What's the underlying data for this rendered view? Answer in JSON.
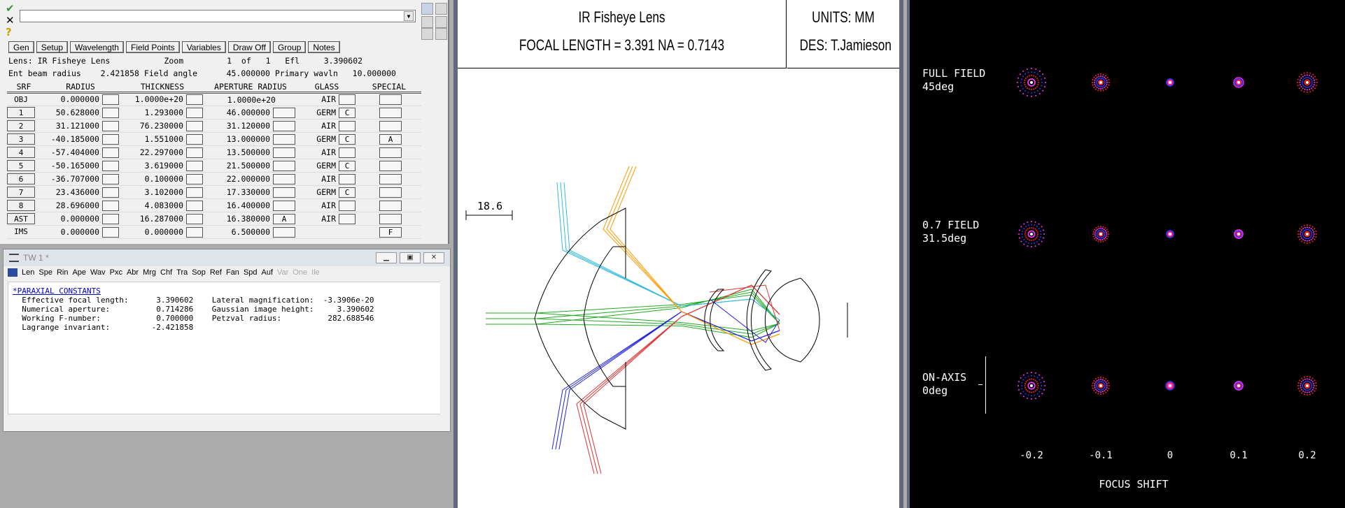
{
  "lens_editor": {
    "buttons": [
      "Gen",
      "Setup",
      "Wavelength",
      "Field Points",
      "Variables",
      "Draw Off",
      "Group",
      "Notes"
    ],
    "info1": {
      "lens_label": "Lens:",
      "lens_name": "IR Fisheye Lens",
      "zoom_label": "Zoom",
      "zoom": "1",
      "of": "of",
      "zoom_total": "1",
      "efl_label": "Efl",
      "efl": "3.390602"
    },
    "info2": {
      "ebr_label": "Ent beam radius",
      "ebr": "2.421858",
      "fa_label": "Field angle",
      "fa": "45.000000",
      "pw_label": "Primary wavln",
      "pw": "10.000000"
    },
    "headers": [
      "SRF",
      "RADIUS",
      "THICKNESS",
      "APERTURE RADIUS",
      "GLASS",
      "SPECIAL"
    ],
    "rows": [
      {
        "srf": "OBJ",
        "radius": "0.000000",
        "thickness": "1.0000e+20",
        "aperture": "1.0000e+20",
        "glass": "AIR",
        "glass_flag": "",
        "special": ""
      },
      {
        "srf": "1",
        "radius": "50.628000",
        "thickness": "1.293000",
        "aperture": "46.000000",
        "glass": "GERM",
        "glass_flag": "C",
        "special": ""
      },
      {
        "srf": "2",
        "radius": "31.121000",
        "thickness": "76.230000",
        "aperture": "31.120000",
        "glass": "AIR",
        "glass_flag": "",
        "special": ""
      },
      {
        "srf": "3",
        "radius": "-40.185000",
        "thickness": "1.551000",
        "aperture": "13.000000",
        "glass": "GERM",
        "glass_flag": "C",
        "special": "A"
      },
      {
        "srf": "4",
        "radius": "-57.404000",
        "thickness": "22.297000",
        "aperture": "13.500000",
        "glass": "AIR",
        "glass_flag": "",
        "special": ""
      },
      {
        "srf": "5",
        "radius": "-50.165000",
        "thickness": "3.619000",
        "aperture": "21.500000",
        "glass": "GERM",
        "glass_flag": "C",
        "special": ""
      },
      {
        "srf": "6",
        "radius": "-36.707000",
        "thickness": "0.100000",
        "aperture": "22.000000",
        "glass": "AIR",
        "glass_flag": "",
        "special": ""
      },
      {
        "srf": "7",
        "radius": "23.436000",
        "thickness": "3.102000",
        "aperture": "17.330000",
        "glass": "GERM",
        "glass_flag": "C",
        "special": ""
      },
      {
        "srf": "8",
        "radius": "28.696000",
        "thickness": "4.083000",
        "aperture": "16.400000",
        "glass": "AIR",
        "glass_flag": "",
        "special": ""
      },
      {
        "srf": "AST",
        "radius": "0.000000",
        "thickness": "16.287000",
        "aperture": "16.380000",
        "glass": "AIR",
        "glass_flag": "",
        "aperture_flag": "A",
        "special": ""
      },
      {
        "srf": "IMS",
        "radius": "0.000000",
        "thickness": "0.000000",
        "aperture": "6.500000",
        "glass": "",
        "glass_flag": "",
        "special": "F"
      }
    ]
  },
  "tw_window": {
    "title": "TW 1 *",
    "menu": [
      "Len",
      "Spe",
      "Rin",
      "Ape",
      "Wav",
      "Pxc",
      "Abr",
      "Mrg",
      "Chf",
      "Tra",
      "Sop",
      "Ref",
      "Fan",
      "Spd",
      "Auf"
    ],
    "menu_disabled": [
      "Var",
      "One",
      "Ile"
    ],
    "section_link": "*PARAXIAL CONSTANTS",
    "lines": [
      "  Effective focal length:      3.390602    Lateral magnification:  -3.3906e-20",
      "  Numerical aperture:          0.714286    Gaussian image height:     3.390602",
      "  Working F-number:            0.700000    Petzval radius:          282.688546",
      "  Lagrange invariant:         -2.421858"
    ]
  },
  "drawing": {
    "title": "IR Fisheye Lens",
    "subtitle": "FOCAL LENGTH = 3.391  NA = 0.7143",
    "units": "UNITS: MM",
    "designer": "DES: T.Jamieson",
    "scale_label": "18.6"
  },
  "spot": {
    "fields": [
      {
        "line1": "FULL FIELD",
        "line2": "45deg"
      },
      {
        "line1": "0.7 FIELD",
        "line2": "31.5deg"
      },
      {
        "line1": "ON-AXIS",
        "line2": "0deg"
      }
    ],
    "focus_values": [
      "-0.2",
      "-0.1",
      "0",
      "0.1",
      "0.2"
    ],
    "axis_title": "FOCUS SHIFT"
  },
  "colors": {
    "ray_green": "#22aa22",
    "ray_blue": "#2222dd",
    "ray_red": "#dd3333",
    "ray_cyan": "#33bbdd",
    "ray_orange": "#ff9900",
    "spot_red": "#ff2222",
    "spot_blue": "#3333ff",
    "spot_magenta": "#ff33ff"
  }
}
